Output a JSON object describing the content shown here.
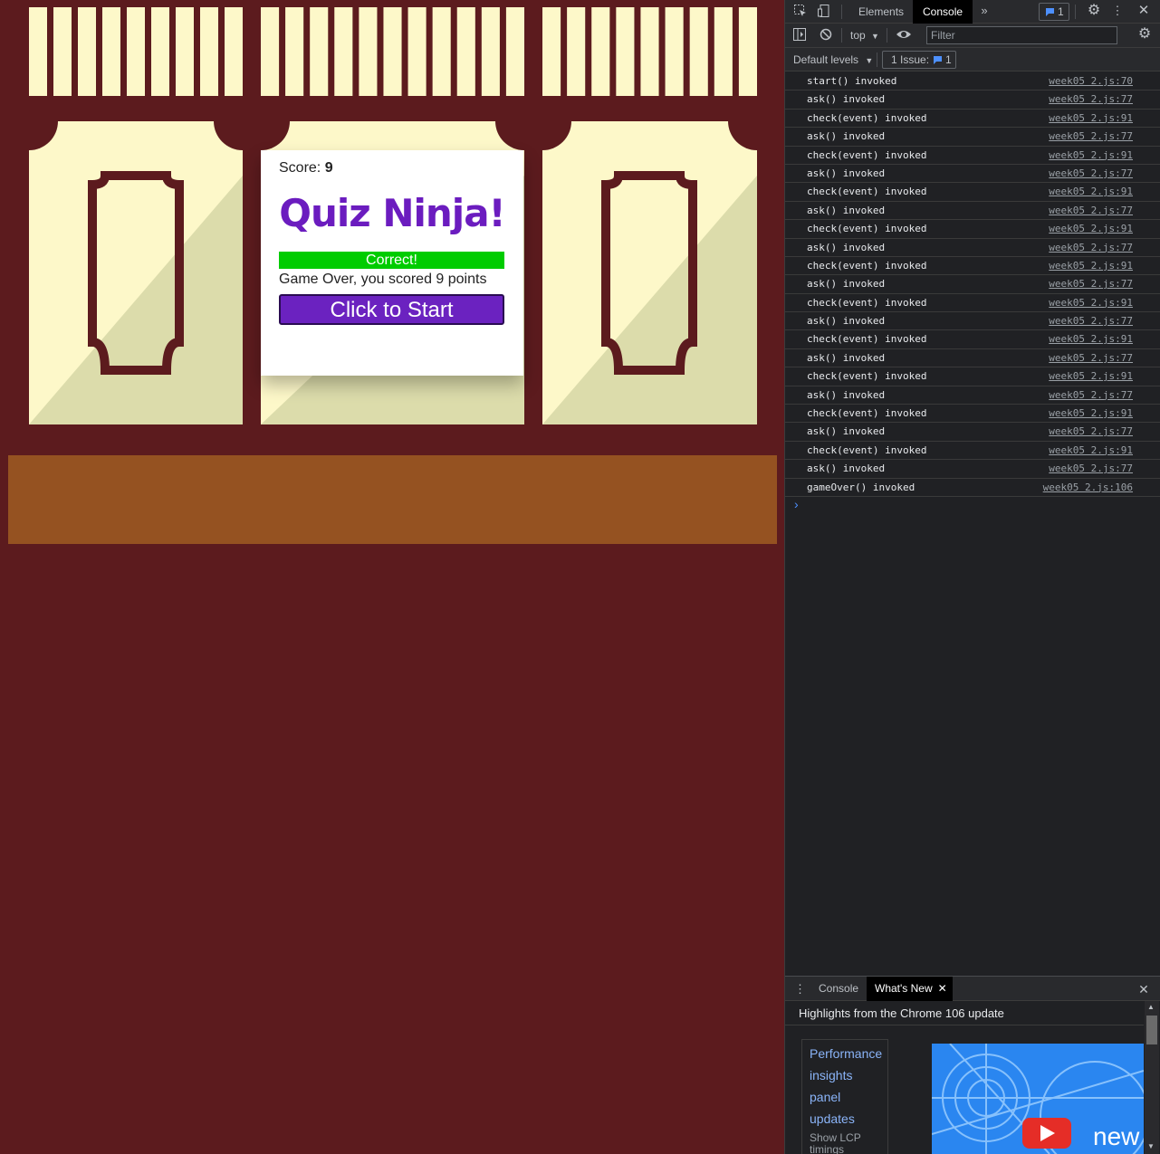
{
  "page": {
    "colors": {
      "background": "#5c1b1e",
      "panel": "#fdf8c9",
      "panel_shade": "#dcdcab",
      "shelf": "#955221"
    },
    "quiz": {
      "score_label": "Score:",
      "score_value": "9",
      "title": "Quiz Ninja!",
      "feedback": "Correct!",
      "gameover_text": "Game Over, you scored 9 points",
      "start_button": "Click to Start",
      "title_color": "#6b1cbf",
      "feedback_color": "#00cc00",
      "button_color": "#6b22c0"
    }
  },
  "devtools": {
    "tabs": [
      {
        "label": "Elements",
        "active": false
      },
      {
        "label": "Console",
        "active": true
      }
    ],
    "more_tabs_icon": "chevron-double-right-icon",
    "message_count": "1",
    "context": "top",
    "filter_placeholder": "Filter",
    "levels": "Default levels",
    "issues_label": "1 Issue:",
    "issues_count": "1",
    "log": [
      {
        "msg": "start() invoked",
        "src": "week05 2.js:70"
      },
      {
        "msg": "ask() invoked",
        "src": "week05 2.js:77"
      },
      {
        "msg": "check(event) invoked",
        "src": "week05 2.js:91"
      },
      {
        "msg": "ask() invoked",
        "src": "week05 2.js:77"
      },
      {
        "msg": "check(event) invoked",
        "src": "week05 2.js:91"
      },
      {
        "msg": "ask() invoked",
        "src": "week05 2.js:77"
      },
      {
        "msg": "check(event) invoked",
        "src": "week05 2.js:91"
      },
      {
        "msg": "ask() invoked",
        "src": "week05 2.js:77"
      },
      {
        "msg": "check(event) invoked",
        "src": "week05 2.js:91"
      },
      {
        "msg": "ask() invoked",
        "src": "week05 2.js:77"
      },
      {
        "msg": "check(event) invoked",
        "src": "week05 2.js:91"
      },
      {
        "msg": "ask() invoked",
        "src": "week05 2.js:77"
      },
      {
        "msg": "check(event) invoked",
        "src": "week05 2.js:91"
      },
      {
        "msg": "ask() invoked",
        "src": "week05 2.js:77"
      },
      {
        "msg": "check(event) invoked",
        "src": "week05 2.js:91"
      },
      {
        "msg": "ask() invoked",
        "src": "week05 2.js:77"
      },
      {
        "msg": "check(event) invoked",
        "src": "week05 2.js:91"
      },
      {
        "msg": "ask() invoked",
        "src": "week05 2.js:77"
      },
      {
        "msg": "check(event) invoked",
        "src": "week05 2.js:91"
      },
      {
        "msg": "ask() invoked",
        "src": "week05 2.js:77"
      },
      {
        "msg": "check(event) invoked",
        "src": "week05 2.js:91"
      },
      {
        "msg": "ask() invoked",
        "src": "week05 2.js:77"
      },
      {
        "msg": "gameOver() invoked",
        "src": "week05 2.js:106"
      }
    ],
    "prompt_symbol": "›",
    "drawer": {
      "tabs": [
        {
          "label": "Console",
          "active": false
        },
        {
          "label": "What's New",
          "active": true
        }
      ],
      "heading": "Highlights from the Chrome 106 update",
      "card_links": [
        "Performance",
        "insights",
        "panel",
        "updates"
      ],
      "card_sub": [
        "Show LCP",
        "timings"
      ],
      "video_word": "new"
    }
  }
}
